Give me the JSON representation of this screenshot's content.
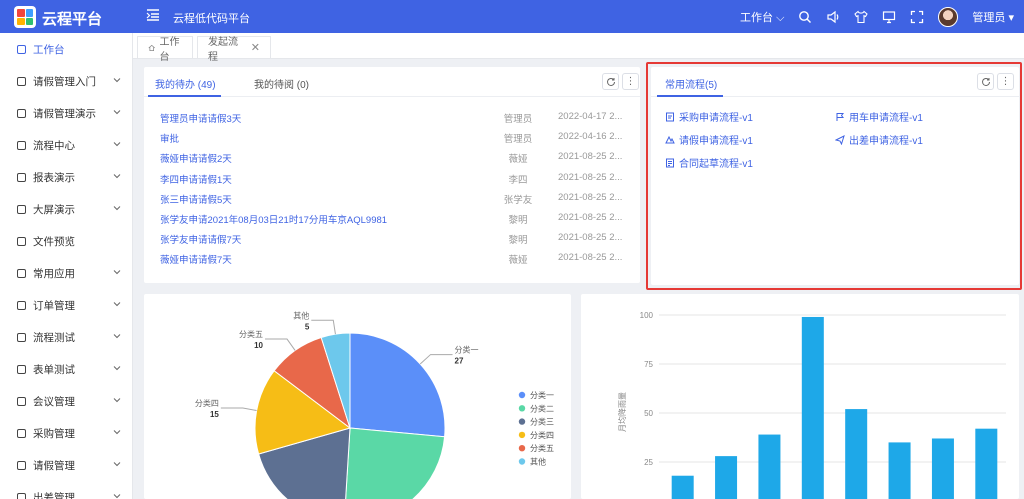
{
  "header": {
    "brand": "云程平台",
    "platform": "云程低代码平台",
    "workspace": "工作台",
    "user": "管理员",
    "logo_colors": [
      "#f2453d",
      "#3f9fff",
      "#ffb300",
      "#2fbf71"
    ],
    "icons": [
      "search-icon",
      "speaker-icon",
      "shirt-icon",
      "monitor-icon",
      "fullscreen-icon"
    ]
  },
  "sidebar": {
    "items": [
      {
        "label": "工作台",
        "icon": "home-icon",
        "active": true,
        "expandable": false
      },
      {
        "label": "请假管理入门",
        "icon": "clipboard-icon",
        "active": false,
        "expandable": true
      },
      {
        "label": "请假管理演示",
        "icon": "document-icon",
        "active": false,
        "expandable": true
      },
      {
        "label": "流程中心",
        "icon": "monitor-icon",
        "active": false,
        "expandable": true
      },
      {
        "label": "报表演示",
        "icon": "pie-icon",
        "active": false,
        "expandable": true
      },
      {
        "label": "大屏演示",
        "icon": "screen-icon",
        "active": false,
        "expandable": true
      },
      {
        "label": "文件预览",
        "icon": "file-icon",
        "active": false,
        "expandable": false
      },
      {
        "label": "常用应用",
        "icon": "bag-icon",
        "active": false,
        "expandable": true
      },
      {
        "label": "订单管理",
        "icon": "card-icon",
        "active": false,
        "expandable": true
      },
      {
        "label": "流程测试",
        "icon": "flow-icon",
        "active": false,
        "expandable": true
      },
      {
        "label": "表单测试",
        "icon": "form-icon",
        "active": false,
        "expandable": true
      },
      {
        "label": "会议管理",
        "icon": "meeting-icon",
        "active": false,
        "expandable": true
      },
      {
        "label": "采购管理",
        "icon": "cart-icon",
        "active": false,
        "expandable": true
      },
      {
        "label": "请假管理",
        "icon": "calendar-icon",
        "active": false,
        "expandable": true
      },
      {
        "label": "出差管理",
        "icon": "plane-icon",
        "active": false,
        "expandable": true
      }
    ]
  },
  "tabs": [
    {
      "label": "工作台",
      "closable": false
    },
    {
      "label": "发起流程",
      "closable": true,
      "close": "✕"
    }
  ],
  "todo": {
    "tab_active": "我的待办 (49)",
    "tab_other": "我的待阅 (0)",
    "rows": [
      {
        "title": "管理员申请请假3天",
        "user": "管理员",
        "date": "2022-04-17 2..."
      },
      {
        "title": "审批",
        "user": "管理员",
        "date": "2022-04-16 2..."
      },
      {
        "title": "薇娅申请请假2天",
        "user": "薇娅",
        "date": "2021-08-25 2..."
      },
      {
        "title": "李四申请请假1天",
        "user": "李四",
        "date": "2021-08-25 2..."
      },
      {
        "title": "张三申请请假5天",
        "user": "张学友",
        "date": "2021-08-25 2..."
      },
      {
        "title": "张学友申请2021年08月03日21时17分用车京AQL9981",
        "user": "黎明",
        "date": "2021-08-25 2..."
      },
      {
        "title": "张学友申请请假7天",
        "user": "黎明",
        "date": "2021-08-25 2..."
      },
      {
        "title": "薇娅申请请假7天",
        "user": "薇娅",
        "date": "2021-08-25 2..."
      }
    ]
  },
  "common": {
    "tab": "常用流程(5)",
    "flows": [
      {
        "label": "采购申请流程-v1",
        "icon": "purchase-icon"
      },
      {
        "label": "用车申请流程-v1",
        "icon": "flag-icon"
      },
      {
        "label": "请假申请流程-v1",
        "icon": "leave-icon"
      },
      {
        "label": "出差申请流程-v1",
        "icon": "send-icon"
      },
      {
        "label": "合同起草流程-v1",
        "icon": "contract-icon"
      }
    ]
  },
  "chart_data": [
    {
      "type": "pie",
      "slices": [
        {
          "name": "分类一",
          "value": 27,
          "color": "#5b8ff9"
        },
        {
          "name": "分类二",
          "value": 25,
          "color": "#5ad8a6"
        },
        {
          "name": "分类三",
          "value": 20,
          "color": "#5d7092"
        },
        {
          "name": "分类四",
          "value": 15,
          "color": "#f6bd16"
        },
        {
          "name": "分类五",
          "value": 10,
          "color": "#e8684a"
        },
        {
          "name": "其他",
          "value": 5,
          "color": "#6dc8ec"
        }
      ],
      "legend": [
        "分类一",
        "分类二",
        "分类三",
        "分类四",
        "分类五",
        "其他"
      ],
      "callouts": [
        {
          "name": "分类一",
          "value": "27"
        },
        {
          "name": "分类四",
          "value": "15"
        },
        {
          "name": "分类五",
          "value": "10"
        },
        {
          "name": "其他",
          "value": "5"
        }
      ],
      "legend_position": "right"
    },
    {
      "type": "bar",
      "ylabel": "月均降雨量",
      "y_ticks": [
        "100",
        "75",
        "50",
        "25"
      ],
      "ylim": [
        0,
        100
      ],
      "values": [
        18,
        28,
        39,
        99,
        52,
        35,
        37,
        42
      ],
      "color": "#1ea8e8",
      "grid": true
    }
  ]
}
